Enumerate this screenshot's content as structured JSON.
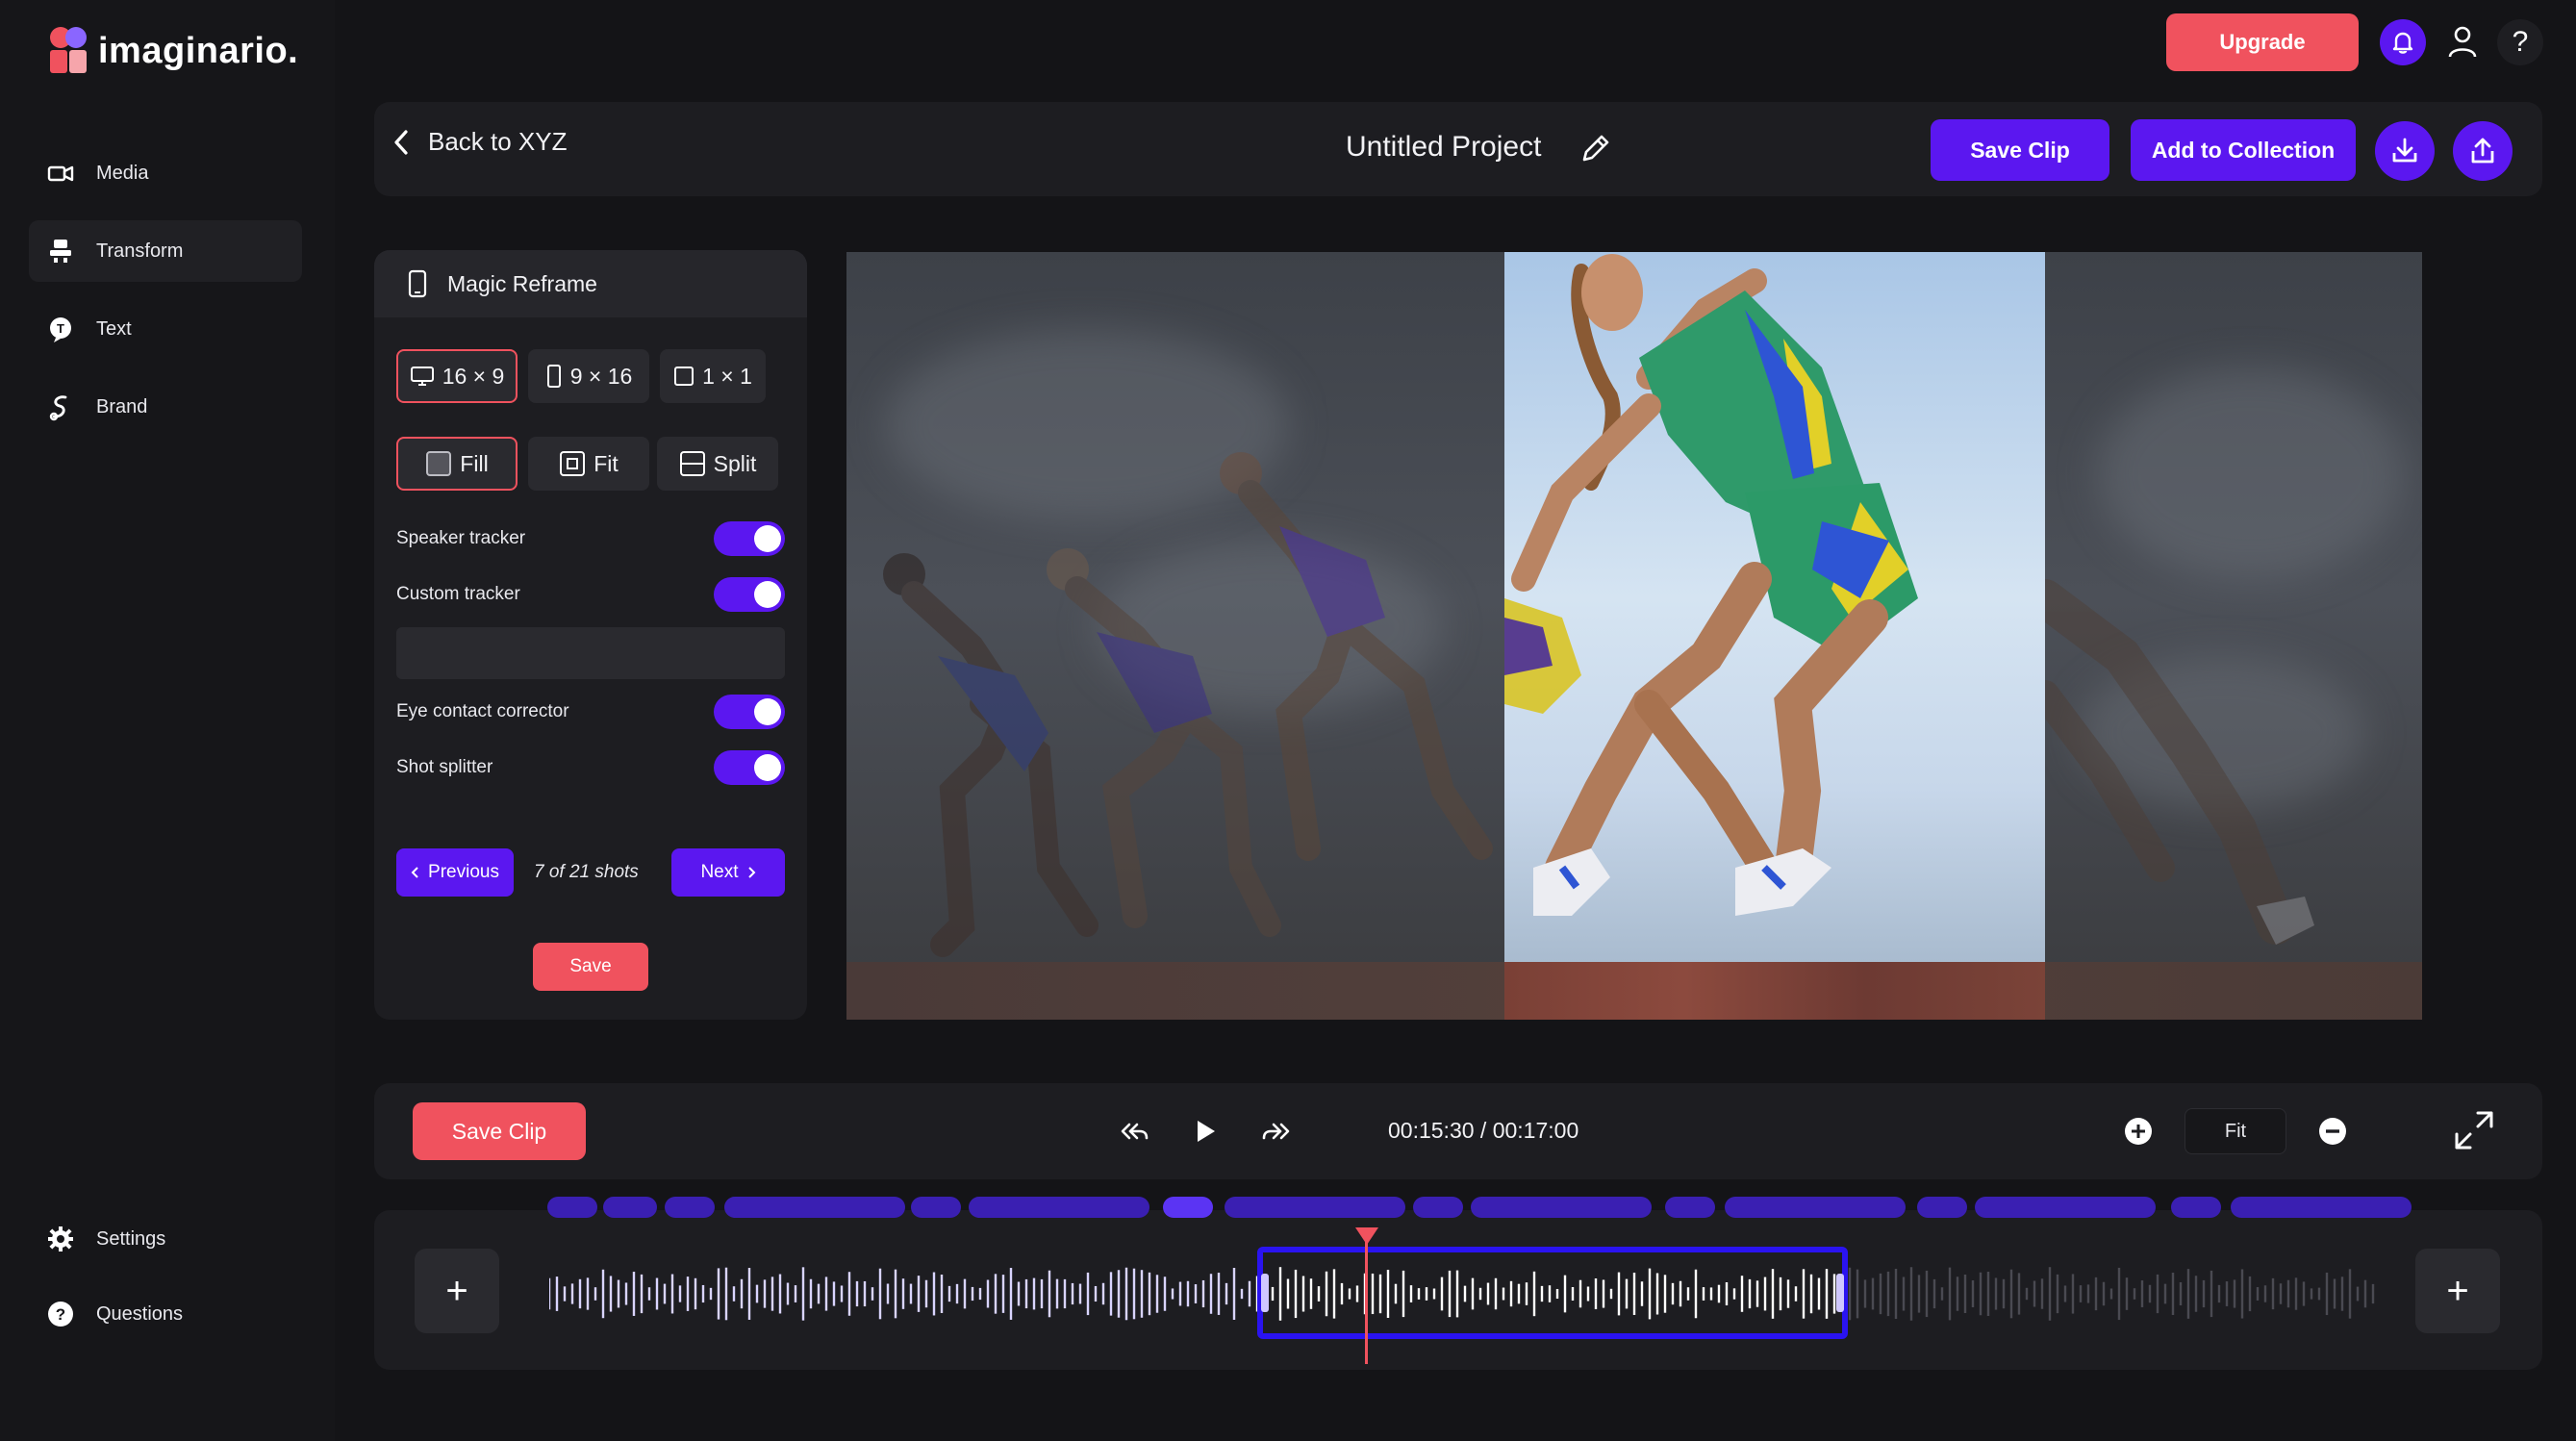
{
  "app": {
    "name": "imaginario.",
    "brand_colors": {
      "coral": "#f0525e",
      "purple": "#5b17f0",
      "bg": "#141417",
      "panel": "#1d1d21"
    }
  },
  "sidebar": {
    "items": [
      {
        "label": "Media",
        "icon": "video-camera-icon",
        "active": false
      },
      {
        "label": "Transform",
        "icon": "transform-icon",
        "active": true
      },
      {
        "label": "Text",
        "icon": "text-bubble-icon",
        "active": false
      },
      {
        "label": "Brand",
        "icon": "brand-icon",
        "active": false
      }
    ],
    "bottom_items": [
      {
        "label": "Settings",
        "icon": "gear-icon"
      },
      {
        "label": "Questions",
        "icon": "question-circle-icon"
      }
    ]
  },
  "header": {
    "upgrade_label": "Upgrade",
    "help_glyph": "?"
  },
  "project_bar": {
    "back_label": "Back to XYZ",
    "title": "Untitled Project",
    "save_clip_label": "Save Clip",
    "add_collection_label": "Add to Collection"
  },
  "panel": {
    "title": "Magic Reframe",
    "aspect_ratios": [
      {
        "label": "16 × 9",
        "selected": true
      },
      {
        "label": "9 × 16",
        "selected": false
      },
      {
        "label": "1 × 1",
        "selected": false
      }
    ],
    "modes": [
      {
        "label": "Fill",
        "selected": true
      },
      {
        "label": "Fit",
        "selected": false
      },
      {
        "label": "Split",
        "selected": false
      }
    ],
    "toggles": [
      {
        "label": "Speaker tracker",
        "on": true
      },
      {
        "label": "Custom tracker",
        "on": true
      },
      {
        "label": "Eye contact corrector",
        "on": true
      },
      {
        "label": "Shot splitter",
        "on": true
      }
    ],
    "custom_tracker_value": "",
    "previous_label": "Previous",
    "next_label": "Next",
    "shots_text": "7 of 21 shots",
    "save_label": "Save"
  },
  "transport": {
    "save_clip_label": "Save Clip",
    "timecode": "00:15:30 / 00:17:00",
    "zoom_label": "Fit"
  },
  "timeline": {
    "add_glyph": "+"
  }
}
